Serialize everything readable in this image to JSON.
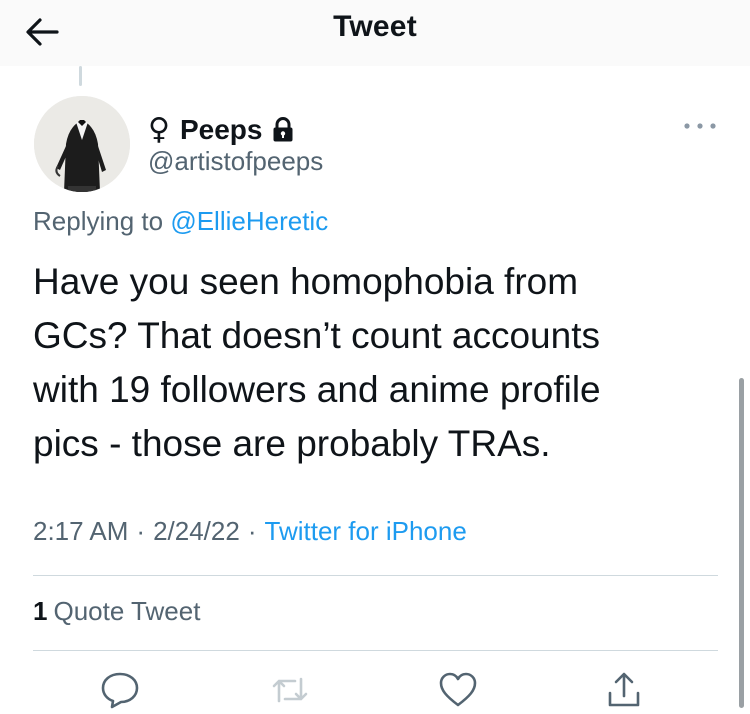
{
  "header": {
    "title": "Tweet"
  },
  "tweet": {
    "author": {
      "symbol": "♀",
      "name": "Peeps",
      "handle": "@artistofpeeps",
      "protected_icon": "lock-icon"
    },
    "replying_prefix": "Replying to",
    "replying_to": "@EllieHeretic",
    "text": "Have you seen homophobia from\nGCs? That doesn’t count accounts\nwith 19 followers and anime profile\npics - those are probably TRAs.",
    "time": "2:17 AM",
    "date": "2/24/22",
    "source": "Twitter for iPhone",
    "separator": "·"
  },
  "stats": {
    "quote_count": "1",
    "quote_label": "Quote Tweet"
  },
  "actions": {
    "icons": [
      "reply-icon",
      "retweet-icon",
      "like-icon",
      "share-icon"
    ]
  },
  "colors": {
    "accent": "#1d9bf0",
    "secondary_text": "#536471",
    "primary_text": "#0f1419",
    "divider": "#cfd9de",
    "retweet_disabled": "#c4ccd1"
  }
}
